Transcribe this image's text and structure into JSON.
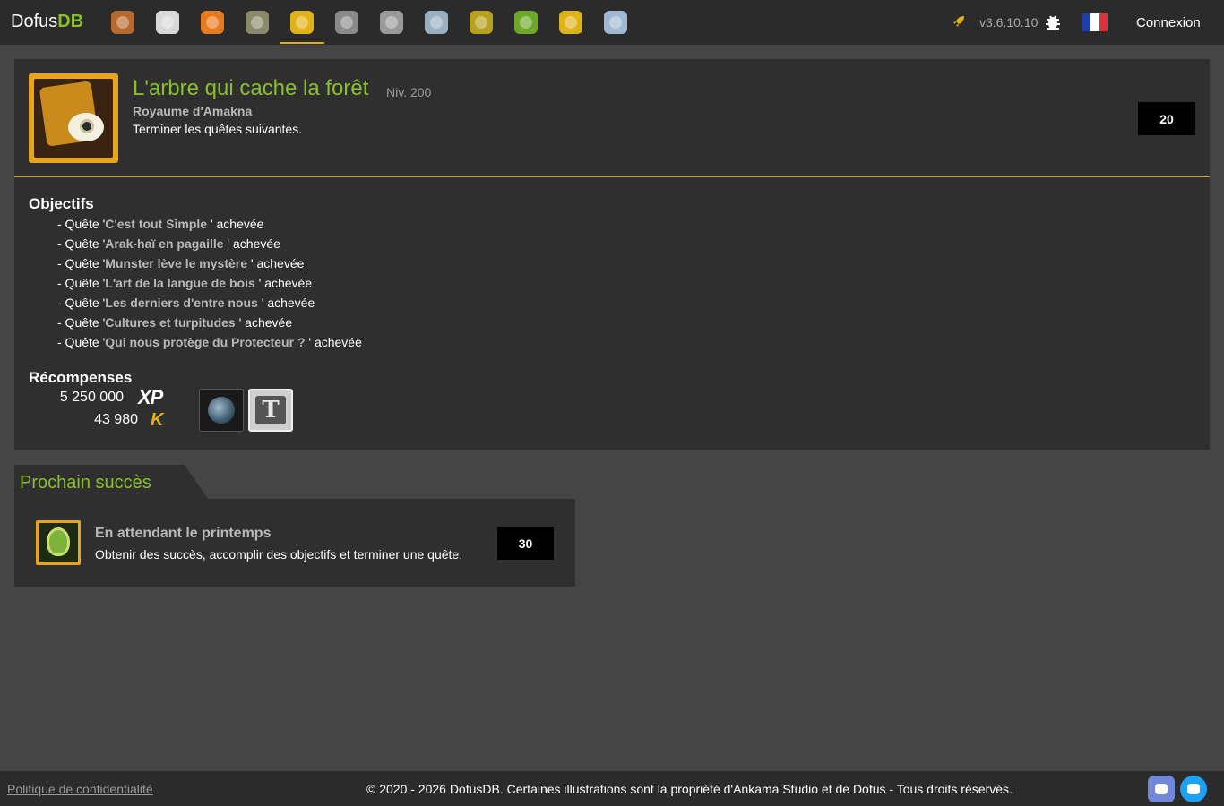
{
  "header": {
    "brand_prefix": "Dofus",
    "brand_suffix": "DB",
    "nav_icons": [
      {
        "icon": "bag-icon",
        "color": "#b86a2e"
      },
      {
        "icon": "monster-icon",
        "color": "#d9d9d9"
      },
      {
        "icon": "character-icon",
        "color": "#e87a1e"
      },
      {
        "icon": "scroll-icon",
        "color": "#8a8a6a"
      },
      {
        "icon": "trophy-icon",
        "color": "#e0b21a",
        "active": true
      },
      {
        "icon": "skull-icon",
        "color": "#8a8a8a"
      },
      {
        "icon": "helmet-icon",
        "color": "#9a9a9a"
      },
      {
        "icon": "crossed-swords-icon",
        "color": "#9ab0c0"
      },
      {
        "icon": "sack-icon",
        "color": "#b8a020"
      },
      {
        "icon": "shirt-icon",
        "color": "#6ea82a"
      },
      {
        "icon": "spell-icon",
        "color": "#e0b21a"
      },
      {
        "icon": "tools-icon",
        "color": "#a0b8d0"
      }
    ],
    "version": "v3.6.10.10",
    "login_label": "Connexion",
    "flag_colors": [
      "#1f3fa8",
      "#ffffff",
      "#e0303a"
    ]
  },
  "achievement": {
    "title": "L'arbre qui cache la forêt",
    "level": "Niv. 200",
    "category": "Royaume d'Amakna",
    "description": "Terminer les quêtes suivantes.",
    "points": "20",
    "objectives_title": "Objectifs",
    "objective_prefix": "- Quête '",
    "objective_suffix": " ' achevée",
    "objectives": [
      "C'est tout Simple",
      "Arak-haï en pagaille",
      "Munster lève le mystère",
      "L'art de la langue de bois",
      "Les derniers d'entre nous",
      "Cultures et turpitudes",
      "Qui nous protège du Protecteur ?"
    ],
    "rewards_title": "Récompenses",
    "xp_value": "5 250 000",
    "xp_label": "XP",
    "kamas_value": "43 980",
    "kamas_icon": "K",
    "title_reward_glyph": "T"
  },
  "next": {
    "tab_label": "Prochain succès",
    "title": "En attendant le printemps",
    "description": "Obtenir des succès, accomplir des objectifs et terminer une quête.",
    "points": "30"
  },
  "footer": {
    "privacy": "Politique de confidentialité",
    "copyright": "© 2020 - 2026 DofusDB. Certaines illustrations sont la propriété d'Ankama Studio et de Dofus - Tous droits réservés."
  },
  "colors": {
    "accent_green": "#8bbf2a",
    "accent_gold": "#e0b21a",
    "card_bg": "#2f2f2f"
  }
}
